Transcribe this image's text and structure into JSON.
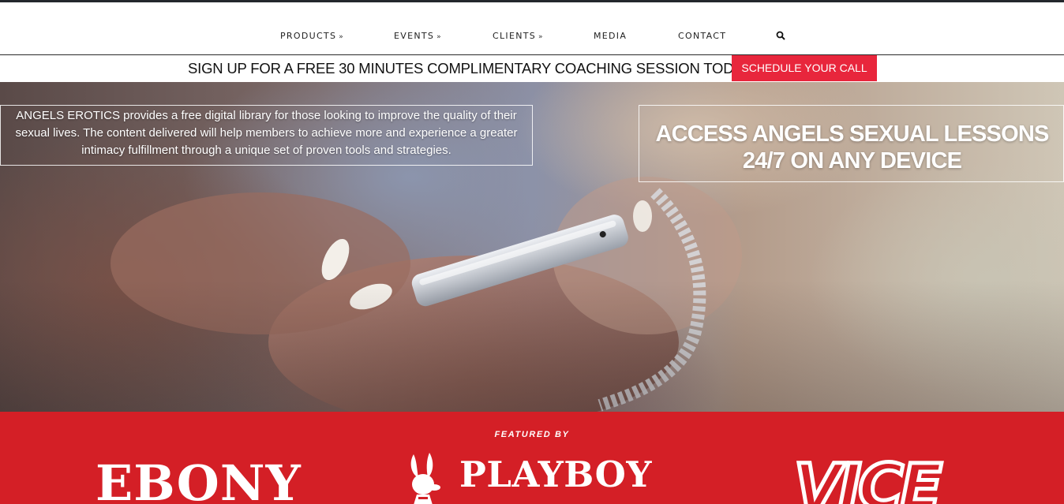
{
  "nav": {
    "items": [
      {
        "label": "PRODUCTS",
        "dropdown": true
      },
      {
        "label": "EVENTS",
        "dropdown": true
      },
      {
        "label": "CLIENTS",
        "dropdown": true
      },
      {
        "label": "MEDIA",
        "dropdown": false
      },
      {
        "label": "CONTACT",
        "dropdown": false
      }
    ],
    "search_icon": "search-icon",
    "dropdown_icon": "double-chevron-down-icon"
  },
  "promo": {
    "text": "SIGN UP FOR A FREE 30 MINUTES COMPLIMENTARY COACHING SESSION TODAY!",
    "button_label": "SCHEDULE YOUR CALL"
  },
  "hero": {
    "intro_text": "ANGELS EROTICS provides a free digital library for those looking to improve the quality of their sexual lives. The content delivered will help members to achieve more and experience a greater intimacy fulfillment through a unique set of proven tools and strategies.",
    "headline_line1": "ACCESS ANGELS SEXUAL LESSONS",
    "headline_line2": "24/7 ON ANY DEVICE"
  },
  "featured": {
    "label": "FEATURED BY",
    "logos": [
      "EBONY",
      "PLAYBOY",
      "VICE"
    ]
  },
  "colors": {
    "accent_red": "#d41f26",
    "button_red": "#e8263c",
    "topbar": "#23272d"
  }
}
